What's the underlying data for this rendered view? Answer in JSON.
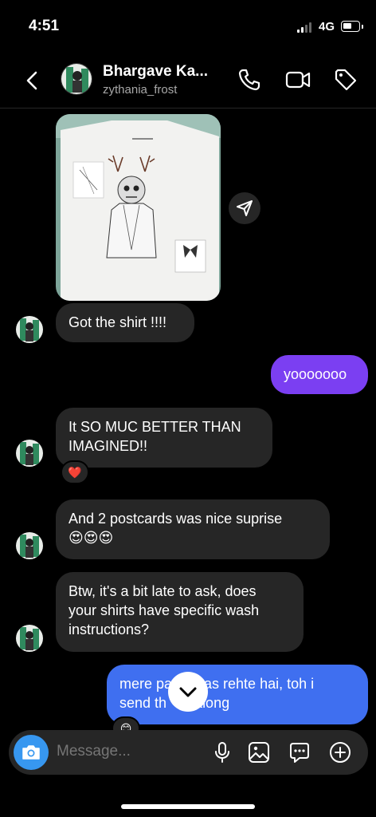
{
  "status": {
    "time": "4:51",
    "network": "4G"
  },
  "header": {
    "name": "Bhargave Ka...",
    "username": "zythania_frost"
  },
  "messages": {
    "m1": "Got the shirt !!!!",
    "m2": "yooooooo",
    "m3_line1": "It SO MUC BETTER THAN",
    "m3_line2": "IMAGINED!!",
    "m3_reaction": "❤️",
    "m4_line1": "And 2 postcards was nice suprise",
    "m4_line2": "😍😍😍",
    "m5_line1": "Btw, it's a bit late to ask, does",
    "m5_line2": "your shirts have specific wash",
    "m5_line3": "instructions?",
    "m6_line1": "mere pa    xtras rehte hai, toh i",
    "m6_line2": "send th       along",
    "m6_reaction": "😊"
  },
  "composer": {
    "placeholder": "Message..."
  },
  "colors": {
    "accent": "#3797f0",
    "outgoing_gradient_start": "#7b3ff2",
    "outgoing_blue": "#3f6ff0",
    "incoming": "#262626"
  },
  "icons": [
    "back-icon",
    "phone-icon",
    "video-icon",
    "tag-icon",
    "share-icon",
    "camera-icon",
    "mic-icon",
    "gallery-icon",
    "sticker-icon",
    "plus-icon",
    "chevron-down-icon"
  ]
}
